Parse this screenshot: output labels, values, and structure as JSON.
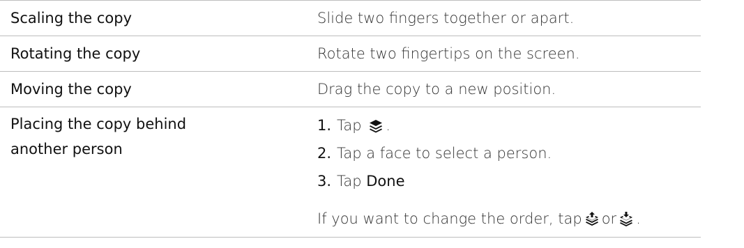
{
  "rows": [
    {
      "action": "Scaling the copy",
      "instruction": "Slide two fingers together or apart."
    },
    {
      "action": "Rotating the copy",
      "instruction": "Rotate two fingertips on the screen."
    },
    {
      "action": "Moving the copy",
      "instruction": "Drag the copy to a new position."
    }
  ],
  "placing": {
    "action_line1": "Placing the copy behind",
    "action_line2": "another person",
    "steps": [
      {
        "num": "1.",
        "text_before": "Tap",
        "icon": "layers-icon",
        "text_after": "."
      },
      {
        "num": "2.",
        "text": "Tap a face to select a person."
      },
      {
        "num": "3.",
        "text_before": "Tap",
        "bold": "Done"
      }
    ],
    "note_before": "If you want to change the order, tap",
    "note_icon1": "layer-up-icon",
    "note_middle": "or",
    "note_icon2": "layer-down-icon",
    "note_after": "."
  }
}
